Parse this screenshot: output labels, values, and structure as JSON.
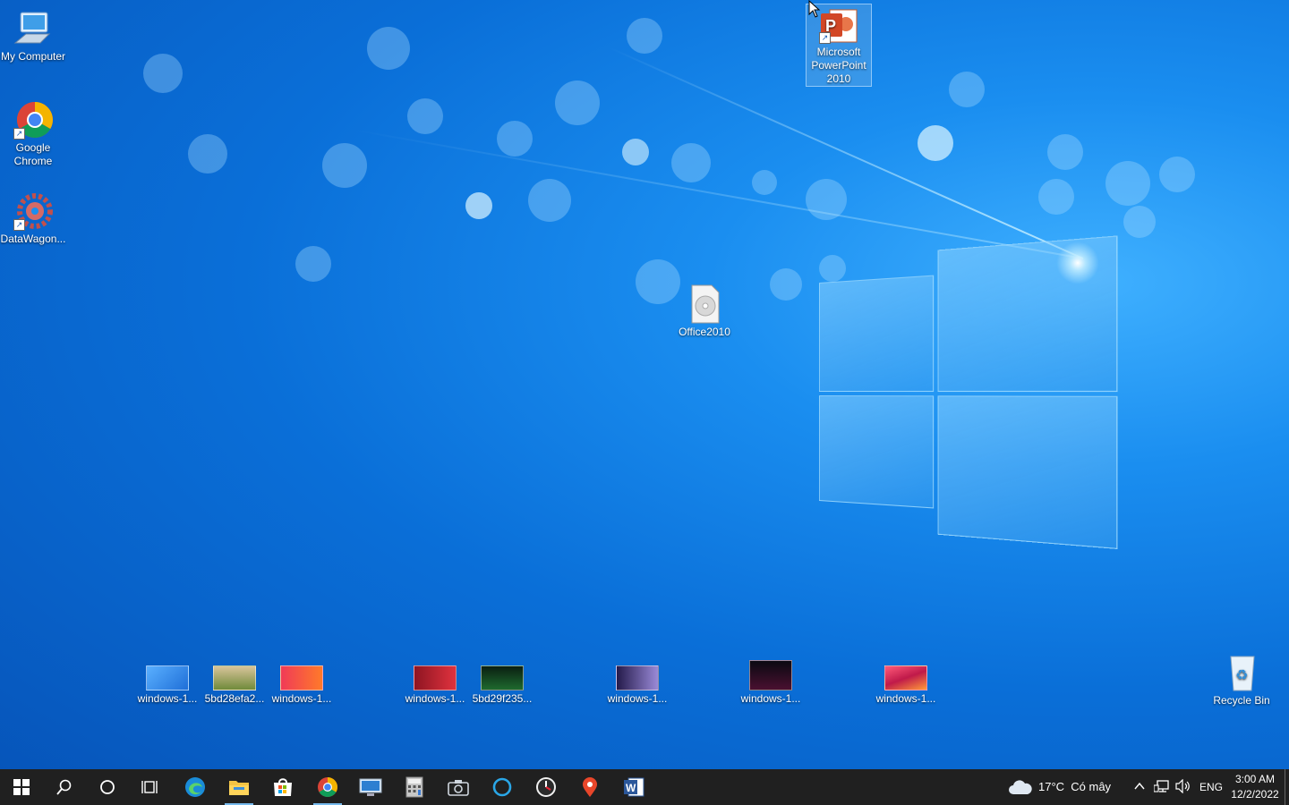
{
  "desktop_icons": {
    "my_computer": "My Computer",
    "chrome": "Google Chrome",
    "datawagon": "DataWagon...",
    "powerpoint": "Microsoft PowerPoint 2010",
    "office2010": "Office2010",
    "recycle_bin": "Recycle Bin"
  },
  "bottom_files": [
    {
      "label": "windows-1...",
      "color": "#1f6fd8"
    },
    {
      "label": "5bd28efa2...",
      "color": "#b08a4a"
    },
    {
      "label": "windows-1...",
      "color": "#f03b57"
    },
    {
      "label": "windows-1...",
      "color": "#b81e2c"
    },
    {
      "label": "5bd29f235...",
      "color": "#0f2a18"
    },
    {
      "label": "windows-1...",
      "color": "#3a2a6a"
    },
    {
      "label": "windows-1...",
      "color": "#1a0b1e"
    },
    {
      "label": "windows-1...",
      "color": "#e8405a"
    }
  ],
  "tray": {
    "weather": "17°C  Có mây",
    "language": "ENG",
    "time": "3:00 AM",
    "date": "12/2/2022"
  },
  "colors": {
    "taskbar": "#202020",
    "accent": "#76b9ed"
  }
}
